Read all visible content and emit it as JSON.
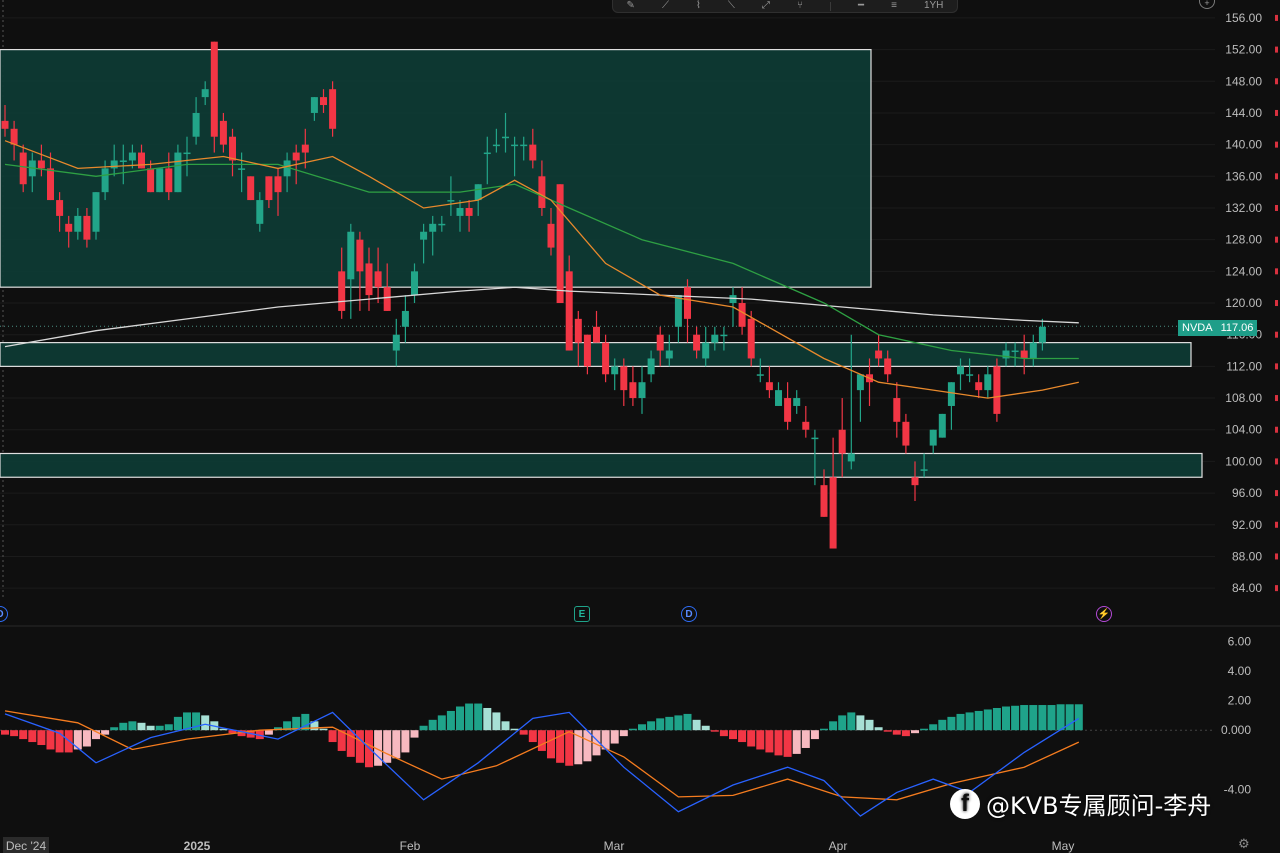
{
  "toolbar": {
    "tools": [
      "brush-icon",
      "path-icon",
      "anchor-icon",
      "trend-icon",
      "ray-icon",
      "fork-icon",
      "hline-icon",
      "fib-icon"
    ],
    "interval_label": "1YH"
  },
  "symbol": "NVDA",
  "last_price": "117.06",
  "watermark": "@KVB专属顾问-李舟",
  "colors": {
    "up": "#22a589",
    "down": "#f23645",
    "ma_fast": "#e8892c",
    "ma_mid": "#2ea043",
    "ma_slow": "#d8d8d8",
    "macd_line": "#2962ff",
    "signal_line": "#f57c1f",
    "zone_fill": "#0e3a34",
    "zone_border": "#e0e0e0"
  },
  "badges": [
    {
      "label": "D",
      "kind": "dividend",
      "date": "Dec '24"
    },
    {
      "label": "E",
      "kind": "earnings",
      "date": "Feb 26"
    },
    {
      "label": "D",
      "kind": "dividend",
      "date": "Mar 12"
    },
    {
      "label": "⚡",
      "kind": "event",
      "date": "May 7"
    }
  ],
  "chart_data": [
    {
      "type": "candlestick",
      "y_ticks": [
        "156.00",
        "152.00",
        "148.00",
        "144.00",
        "140.00",
        "136.00",
        "132.00",
        "128.00",
        "124.00",
        "120.00",
        "116.00",
        "112.00",
        "108.00",
        "104.00",
        "100.00",
        "96.00",
        "92.00",
        "88.00",
        "84.00"
      ],
      "ylim": [
        82.5,
        157
      ],
      "x_ticks": [
        "Dec '24",
        "2025",
        "Feb",
        "Mar",
        "Apr",
        "May"
      ],
      "zones": [
        {
          "from": 122,
          "to": 152
        },
        {
          "from": 112,
          "to": 115
        },
        {
          "from": 98,
          "to": 101
        }
      ],
      "candles": [
        [
          143,
          145,
          141,
          142
        ],
        [
          142,
          143,
          138,
          140
        ],
        [
          139,
          140,
          134,
          135
        ],
        [
          136,
          139,
          134,
          138
        ],
        [
          138,
          140,
          136,
          137
        ],
        [
          137,
          139,
          133,
          133
        ],
        [
          133,
          134,
          129,
          131
        ],
        [
          130,
          131,
          127,
          129
        ],
        [
          129,
          132,
          128,
          131
        ],
        [
          131,
          132,
          127,
          128
        ],
        [
          129,
          134,
          128,
          134
        ],
        [
          134,
          138,
          133,
          137
        ],
        [
          137,
          140,
          136,
          138
        ],
        [
          138,
          140,
          135,
          138
        ],
        [
          138,
          140,
          137,
          139
        ],
        [
          139,
          140,
          137,
          137
        ],
        [
          137,
          138,
          134,
          134
        ],
        [
          134,
          137,
          134,
          137
        ],
        [
          137,
          139,
          133,
          134
        ],
        [
          134,
          140,
          134,
          139
        ],
        [
          139,
          141,
          136,
          139
        ],
        [
          141,
          146,
          140,
          144
        ],
        [
          146,
          148,
          145,
          147
        ],
        [
          153,
          153,
          139,
          141
        ],
        [
          143,
          144,
          139,
          140
        ],
        [
          141,
          142,
          136,
          138
        ],
        [
          137,
          139,
          134,
          137
        ],
        [
          136,
          136,
          133,
          133
        ],
        [
          130,
          134,
          129,
          133
        ],
        [
          136,
          136,
          132,
          133
        ],
        [
          136,
          137,
          131,
          134
        ],
        [
          136,
          139,
          134,
          138
        ],
        [
          139,
          140,
          135,
          138
        ],
        [
          140,
          142,
          137,
          139
        ],
        [
          144,
          146,
          143,
          146
        ],
        [
          146,
          147,
          144,
          145
        ],
        [
          147,
          148,
          141,
          142
        ],
        [
          124,
          127,
          118,
          119
        ],
        [
          123,
          130,
          118,
          129
        ],
        [
          128,
          129,
          119,
          124
        ],
        [
          125,
          127,
          119,
          121
        ],
        [
          124,
          127,
          120,
          122
        ],
        [
          122,
          125,
          119,
          119
        ],
        [
          114,
          118,
          112,
          116
        ],
        [
          117,
          121,
          115,
          119
        ],
        [
          121,
          125,
          120,
          124
        ],
        [
          128,
          130,
          125,
          129
        ],
        [
          129,
          131,
          126,
          130
        ],
        [
          130,
          131,
          129,
          130
        ],
        [
          133,
          136,
          131,
          133
        ],
        [
          131,
          133,
          129,
          132
        ],
        [
          132,
          133,
          129,
          131
        ],
        [
          133,
          135,
          131,
          135
        ],
        [
          139,
          141,
          135,
          139
        ],
        [
          140,
          142,
          139,
          140
        ],
        [
          141,
          144,
          139,
          141
        ],
        [
          140,
          141,
          136,
          140
        ],
        [
          140,
          141,
          138,
          140
        ],
        [
          140,
          142,
          137,
          138
        ],
        [
          136,
          138,
          131,
          132
        ],
        [
          130,
          132,
          126,
          127
        ],
        [
          135,
          135,
          120,
          120
        ],
        [
          124,
          126,
          114,
          114
        ],
        [
          118,
          119,
          112,
          115
        ],
        [
          116,
          116,
          111,
          112
        ],
        [
          117,
          119,
          115,
          115
        ],
        [
          115,
          116,
          110,
          111
        ],
        [
          111,
          113,
          109,
          112
        ],
        [
          112,
          113,
          107,
          109
        ],
        [
          110,
          112,
          107,
          108
        ],
        [
          108,
          112,
          106,
          110
        ],
        [
          111,
          114,
          110,
          113
        ],
        [
          116,
          117,
          112,
          114
        ],
        [
          113,
          116,
          112,
          114
        ],
        [
          117,
          121,
          115,
          121
        ],
        [
          122,
          123,
          115,
          118
        ],
        [
          116,
          117,
          113,
          114
        ],
        [
          113,
          117,
          112,
          115
        ],
        [
          115,
          117,
          114,
          116
        ],
        [
          116,
          117,
          114,
          116
        ],
        [
          120,
          122,
          117,
          121
        ],
        [
          120,
          122,
          116,
          117
        ],
        [
          118,
          119,
          112,
          113
        ],
        [
          111,
          113,
          110,
          111
        ],
        [
          110,
          112,
          108,
          109
        ],
        [
          107,
          110,
          107,
          109
        ],
        [
          108,
          110,
          104,
          105
        ],
        [
          107,
          109,
          106,
          108
        ],
        [
          105,
          107,
          103,
          104
        ],
        [
          103,
          104,
          97,
          103
        ],
        [
          97,
          99,
          93,
          93
        ],
        [
          98,
          103,
          89,
          89
        ],
        [
          104,
          108,
          98,
          101
        ],
        [
          100,
          116,
          99,
          101
        ],
        [
          109,
          111,
          105,
          111
        ],
        [
          111,
          113,
          107,
          110
        ],
        [
          114,
          116,
          112,
          113
        ],
        [
          113,
          114,
          110,
          111
        ],
        [
          108,
          110,
          103,
          105
        ],
        [
          105,
          106,
          101,
          102
        ],
        [
          98,
          100,
          95,
          97
        ],
        [
          99,
          101,
          98,
          99
        ],
        [
          102,
          104,
          101,
          104
        ],
        [
          103,
          106,
          103,
          106
        ],
        [
          107,
          110,
          104,
          110
        ],
        [
          111,
          113,
          109,
          112
        ],
        [
          111,
          113,
          110,
          111
        ],
        [
          110,
          111,
          108,
          109
        ],
        [
          109,
          112,
          108,
          111
        ],
        [
          112,
          113,
          105,
          106
        ],
        [
          113,
          115,
          112,
          114
        ],
        [
          114,
          115,
          112,
          114
        ],
        [
          114,
          116,
          111,
          113
        ],
        [
          113,
          116,
          112,
          115
        ],
        [
          115,
          118,
          114,
          117
        ]
      ],
      "ma_fast_anchors": [
        [
          0,
          140.5
        ],
        [
          8,
          137
        ],
        [
          16,
          137.5
        ],
        [
          24,
          138.5
        ],
        [
          30,
          137
        ],
        [
          36,
          138.5
        ],
        [
          40,
          136
        ],
        [
          46,
          132
        ],
        [
          52,
          133
        ],
        [
          56,
          135.5
        ],
        [
          60,
          133
        ],
        [
          66,
          125
        ],
        [
          72,
          121
        ],
        [
          80,
          119.5
        ],
        [
          90,
          113
        ],
        [
          96,
          110
        ],
        [
          102,
          109
        ],
        [
          108,
          108
        ],
        [
          114,
          109
        ],
        [
          118,
          110
        ]
      ],
      "ma_mid_anchors": [
        [
          0,
          137.5
        ],
        [
          10,
          136
        ],
        [
          20,
          137.5
        ],
        [
          30,
          137.5
        ],
        [
          40,
          134
        ],
        [
          50,
          134
        ],
        [
          56,
          135
        ],
        [
          62,
          132
        ],
        [
          70,
          128
        ],
        [
          80,
          125
        ],
        [
          90,
          120
        ],
        [
          96,
          116
        ],
        [
          104,
          114
        ],
        [
          112,
          113
        ],
        [
          118,
          113
        ]
      ],
      "ma_slow_anchors": [
        [
          0,
          114.5
        ],
        [
          10,
          116.5
        ],
        [
          20,
          118
        ],
        [
          30,
          119.5
        ],
        [
          40,
          120.5
        ],
        [
          50,
          121.5
        ],
        [
          56,
          122
        ],
        [
          62,
          121.5
        ],
        [
          72,
          121
        ],
        [
          82,
          120.5
        ],
        [
          92,
          119.5
        ],
        [
          102,
          118.5
        ],
        [
          112,
          117.8
        ],
        [
          118,
          117.5
        ]
      ]
    },
    {
      "type": "macd",
      "y_ticks": [
        "6.00",
        "4.00",
        "2.00",
        "0.000",
        "-4.00"
      ],
      "ylim": [
        -6.4,
        6.9
      ],
      "histogram": [
        -0.3,
        -0.4,
        -0.6,
        -0.8,
        -1,
        -1.3,
        -1.5,
        -1.5,
        -1.3,
        -1.1,
        -0.6,
        -0.3,
        0.2,
        0.5,
        0.6,
        0.5,
        0.3,
        0.3,
        0.4,
        0.9,
        1.2,
        1.2,
        1,
        0.6,
        0.1,
        -0.2,
        -0.4,
        -0.5,
        -0.6,
        -0.3,
        0.2,
        0.6,
        0.9,
        1.1,
        0.6,
        0.1,
        -0.8,
        -1.4,
        -1.8,
        -2.2,
        -2.5,
        -2.4,
        -2.2,
        -1.9,
        -1.5,
        -0.5,
        0.3,
        0.7,
        1,
        1.3,
        1.6,
        1.8,
        1.8,
        1.5,
        1.2,
        0.6,
        0.1,
        -0.3,
        -0.8,
        -1.4,
        -1.9,
        -2.2,
        -2.4,
        -2.3,
        -2.1,
        -1.7,
        -1.3,
        -0.9,
        -0.4,
        0.1,
        0.4,
        0.6,
        0.8,
        0.9,
        1,
        1.1,
        0.7,
        0.3,
        -0.1,
        -0.4,
        -0.6,
        -0.8,
        -1.1,
        -1.3,
        -1.5,
        -1.7,
        -1.8,
        -1.6,
        -1.2,
        -0.6,
        0.1,
        0.6,
        1,
        1.2,
        1,
        0.7,
        0.2,
        -0.1,
        -0.3,
        -0.4,
        -0.2,
        0.1,
        0.4,
        0.7,
        0.9,
        1.1,
        1.2,
        1.3,
        1.4,
        1.5,
        1.6,
        1.65,
        1.7,
        1.7,
        1.7,
        1.7,
        1.75,
        1.75,
        1.75
      ],
      "macd_anchors": [
        [
          0,
          1.1
        ],
        [
          6,
          -0.2
        ],
        [
          10,
          -2.2
        ],
        [
          16,
          -0.5
        ],
        [
          22,
          0.4
        ],
        [
          30,
          -0.6
        ],
        [
          36,
          1.2
        ],
        [
          40,
          -1.2
        ],
        [
          46,
          -4.7
        ],
        [
          52,
          -2.2
        ],
        [
          58,
          0.8
        ],
        [
          62,
          1.2
        ],
        [
          68,
          -2.5
        ],
        [
          74,
          -5.5
        ],
        [
          80,
          -3.7
        ],
        [
          86,
          -2.5
        ],
        [
          90,
          -3.4
        ],
        [
          94,
          -5.8
        ],
        [
          98,
          -4.2
        ],
        [
          102,
          -3.3
        ],
        [
          106,
          -4.2
        ],
        [
          112,
          -1.5
        ],
        [
          118,
          0.8
        ]
      ],
      "signal_anchors": [
        [
          0,
          1.3
        ],
        [
          8,
          0.5
        ],
        [
          14,
          -1.3
        ],
        [
          20,
          -0.6
        ],
        [
          28,
          0
        ],
        [
          36,
          0.2
        ],
        [
          42,
          -1.6
        ],
        [
          48,
          -3.3
        ],
        [
          54,
          -2.4
        ],
        [
          62,
          -0.1
        ],
        [
          68,
          -1.8
        ],
        [
          74,
          -4.5
        ],
        [
          80,
          -4.4
        ],
        [
          86,
          -3.3
        ],
        [
          92,
          -4.5
        ],
        [
          98,
          -4.7
        ],
        [
          104,
          -3.6
        ],
        [
          112,
          -2.5
        ],
        [
          118,
          -0.8
        ]
      ]
    }
  ]
}
